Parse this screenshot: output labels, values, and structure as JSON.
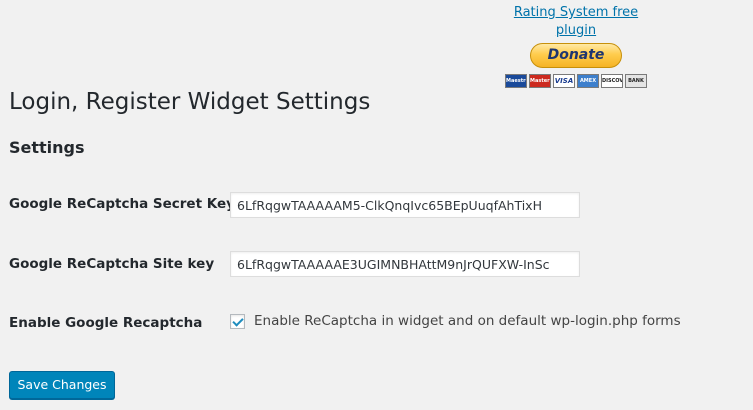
{
  "promo": {
    "link_text": "Rating System free plugin",
    "donate_label": "Donate",
    "cards": [
      {
        "icon": "maestro-card-icon",
        "label": "Maestro"
      },
      {
        "icon": "mastercard-icon",
        "label": "MasterCard"
      },
      {
        "icon": "visa-card-icon",
        "label": "VISA"
      },
      {
        "icon": "amex-card-icon",
        "label": "AMEX"
      },
      {
        "icon": "discover-card-icon",
        "label": "DISCOVER"
      },
      {
        "icon": "bank-icon",
        "label": "BANK"
      }
    ]
  },
  "page": {
    "title": "Login, Register Widget Settings",
    "section_title": "Settings"
  },
  "fields": {
    "secret_key": {
      "label": "Google ReCaptcha Secret Key",
      "value": "6LfRqgwTAAAAAM5-ClkQnqIvc65BEpUuqfAhTixH"
    },
    "site_key": {
      "label": "Google ReCaptcha Site key",
      "value": "6LfRqgwTAAAAAE3UGIMNBHAttM9nJrQUFXW-InSc"
    },
    "enable_recaptcha": {
      "label": "Enable Google Recaptcha",
      "checkbox_label": "Enable ReCaptcha in widget and on default wp-login.php forms",
      "checked": true
    }
  },
  "actions": {
    "save_label": "Save Changes"
  }
}
